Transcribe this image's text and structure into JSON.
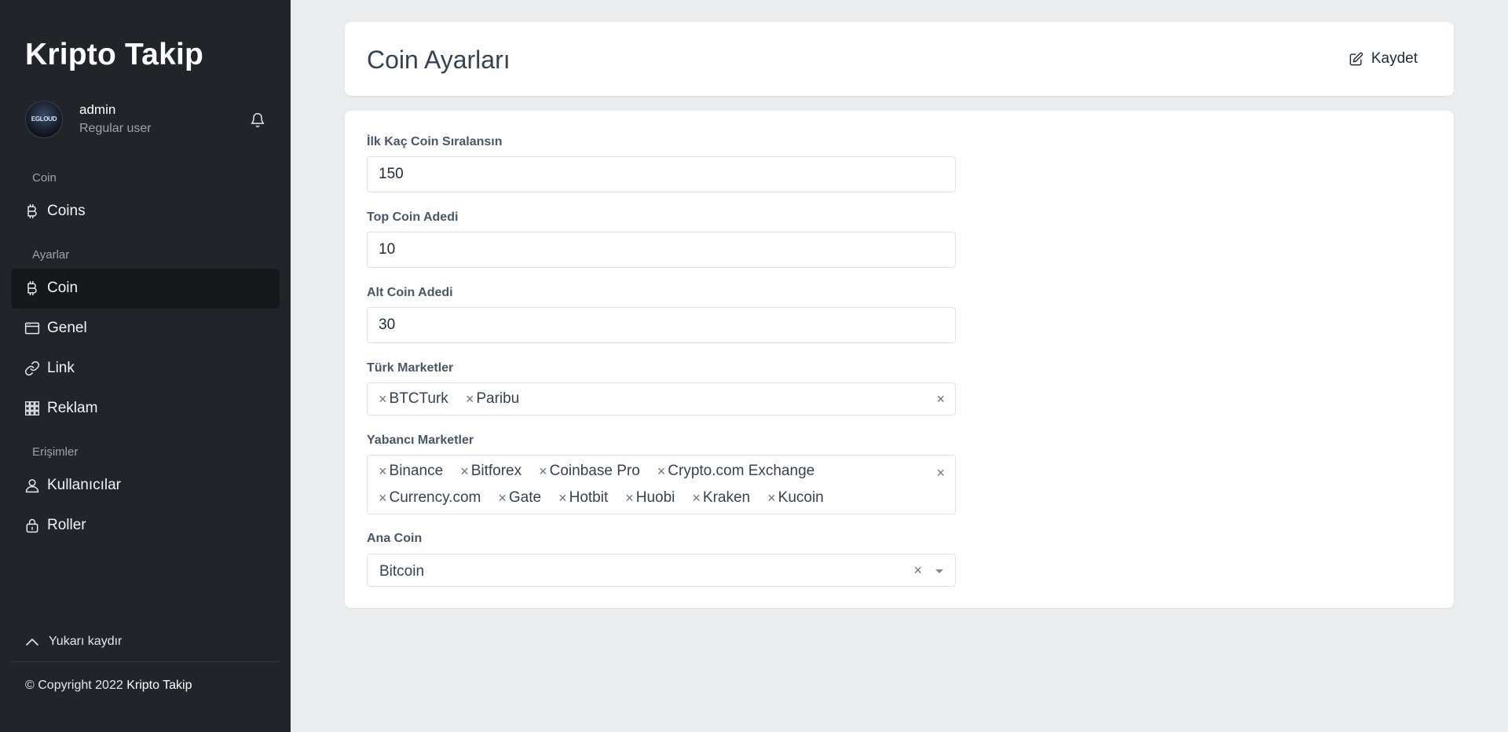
{
  "app": {
    "brand": "Kripto Takip"
  },
  "user": {
    "avatar_text": "EGLOUD",
    "name": "admin",
    "role": "Regular user"
  },
  "sidebar": {
    "sections": [
      {
        "header": "Coin"
      },
      {
        "header": "Ayarlar"
      },
      {
        "header": "Erişimler"
      }
    ],
    "items": [
      {
        "label": "Coins",
        "icon": "bitcoin-icon"
      },
      {
        "label": "Coin",
        "icon": "bitcoin-icon",
        "active": true
      },
      {
        "label": "Genel",
        "icon": "window-icon"
      },
      {
        "label": "Link",
        "icon": "link-icon"
      },
      {
        "label": "Reklam",
        "icon": "grid-icon"
      },
      {
        "label": "Kullanıcılar",
        "icon": "user-icon"
      },
      {
        "label": "Roller",
        "icon": "lock-icon"
      }
    ],
    "scroll_top_label": "Yukarı kaydır",
    "copyright_prefix": "© Copyright 2022",
    "copyright_brand": "Kripto Takip"
  },
  "header": {
    "title": "Coin Ayarları",
    "save_label": "Kaydet"
  },
  "form": {
    "first_count": {
      "label": "İlk Kaç Coin Sıralansın",
      "value": "150"
    },
    "top_count": {
      "label": "Top Coin Adedi",
      "value": "10"
    },
    "alt_count": {
      "label": "Alt Coin Adedi",
      "value": "30"
    },
    "turkish_markets": {
      "label": "Türk Marketler",
      "tags": [
        "BTCTurk",
        "Paribu"
      ]
    },
    "foreign_markets": {
      "label": "Yabancı Marketler",
      "tags": [
        "Binance",
        "Bitforex",
        "Coinbase Pro",
        "Crypto.com Exchange",
        "Currency.com",
        "Gate",
        "Hotbit",
        "Huobi",
        "Kraken",
        "Kucoin"
      ]
    },
    "main_coin": {
      "label": "Ana Coin",
      "value": "Bitcoin"
    }
  },
  "colors": {
    "sidebar_bg": "#212529",
    "sidebar_active_bg": "#16191c",
    "page_bg": "#ebecee",
    "card_bg": "#ffffff"
  }
}
